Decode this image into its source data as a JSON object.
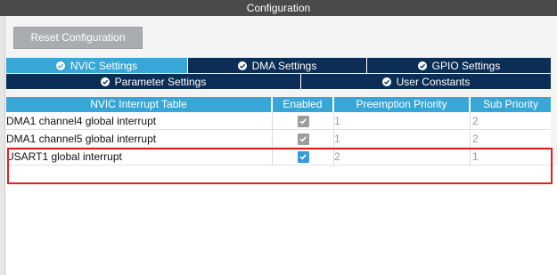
{
  "window": {
    "title": "Configuration"
  },
  "toolbar": {
    "reset_label": "Reset Configuration"
  },
  "tabs": {
    "row1": [
      {
        "label": "NVIC Settings",
        "active": true
      },
      {
        "label": "DMA Settings",
        "active": false
      },
      {
        "label": "GPIO Settings",
        "active": false
      }
    ],
    "row2": [
      {
        "label": "Parameter Settings",
        "active": false
      },
      {
        "label": "User Constants",
        "active": false
      }
    ]
  },
  "table": {
    "headers": {
      "name": "NVIC Interrupt Table",
      "enabled": "Enabled",
      "preemption": "Preemption Priority",
      "sub": "Sub Priority"
    },
    "rows": [
      {
        "name": "DMA1 channel4 global interrupt",
        "enabled": true,
        "enabled_editable": false,
        "preemption": "1",
        "sub": "2"
      },
      {
        "name": "DMA1 channel5 global interrupt",
        "enabled": true,
        "enabled_editable": false,
        "preemption": "1",
        "sub": "2"
      },
      {
        "name": "USART1 global interrupt",
        "enabled": true,
        "enabled_editable": true,
        "preemption": "2",
        "sub": "1"
      }
    ]
  },
  "colors": {
    "accent": "#38a7d7",
    "tab_inactive": "#0b2d56",
    "title_bar": "#4a4a4a",
    "highlight": "#e0211d"
  },
  "icons": {
    "tab_status": "check-circle-icon",
    "checkbox": "checkmark-icon"
  }
}
